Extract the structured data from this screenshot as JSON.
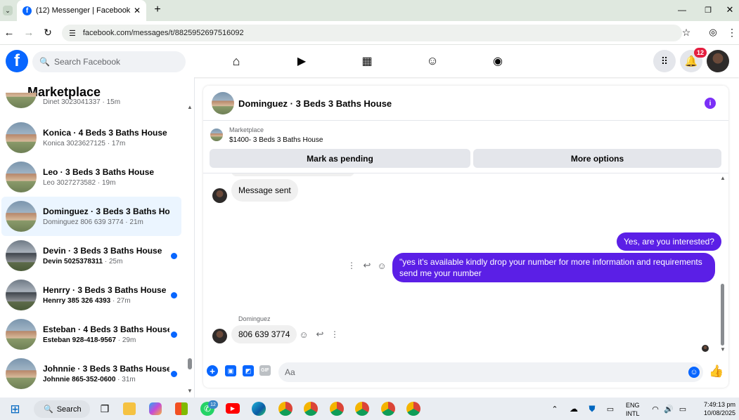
{
  "browser": {
    "tab_title": "(12) Messenger | Facebook",
    "url": "facebook.com/messages/t/8825952697516092"
  },
  "fb": {
    "search_placeholder": "Search Facebook",
    "notif_badge": "12"
  },
  "sidebar": {
    "title": "Marketplace",
    "partial_text": "Dinet 3023041337 · 15m",
    "items": [
      {
        "title": "Konica · 4 Beds 3 Baths House",
        "sub": "Konica 3023627125 · 17m",
        "unread": false
      },
      {
        "title": "Leo · 3 Beds 3 Baths House",
        "sub": "Leo 3027273582 · 19m",
        "unread": false
      },
      {
        "title": "Dominguez · 3 Beds 3 Baths Ho...",
        "sub": "Dominguez 806 639 3774 · 21m",
        "unread": false
      },
      {
        "title": "Devin · 3 Beds 3 Baths House",
        "sub": "Devin 5025378311",
        "time": " · 25m",
        "unread": true
      },
      {
        "title": "Henrry · 3 Beds 3 Baths House",
        "sub": "Henrry 385 326 4393",
        "time": " · 27m",
        "unread": true
      },
      {
        "title": "Esteban · 4 Beds 3 Baths House",
        "sub": "Esteban 928-418-9567",
        "time": " · 29m",
        "unread": true
      },
      {
        "title": "Johnnie · 3 Beds 3 Baths House",
        "sub": "Johnnie 865-352-0600",
        "time": " · 31m",
        "unread": true
      }
    ]
  },
  "chat": {
    "header_title": "Dominguez · 3 Beds 3 Baths House",
    "listing": {
      "label": "Marketplace",
      "price_title": "$1400- 3 Beds 3 Baths House"
    },
    "mark_pending": "Mark as pending",
    "more_options": "More options",
    "messages": {
      "sent_status": "Message sent",
      "out1": "Yes, are you interested?",
      "out2": "\"yes it's available kindly drop your number for more information and requirements send me your number",
      "sender": "Dominguez",
      "in1": "806 639 3774"
    },
    "composer_placeholder": "Aa"
  },
  "taskbar": {
    "search": "Search",
    "lang1": "ENG",
    "lang2": "INTL",
    "time": "7:49:13 pm",
    "date": "10/08/2025",
    "whatsapp_badge": "12"
  },
  "colors": {
    "fb_blue": "#0866ff",
    "messenger_purple": "#5b1fe6",
    "active_conv": "#ebf5ff"
  }
}
